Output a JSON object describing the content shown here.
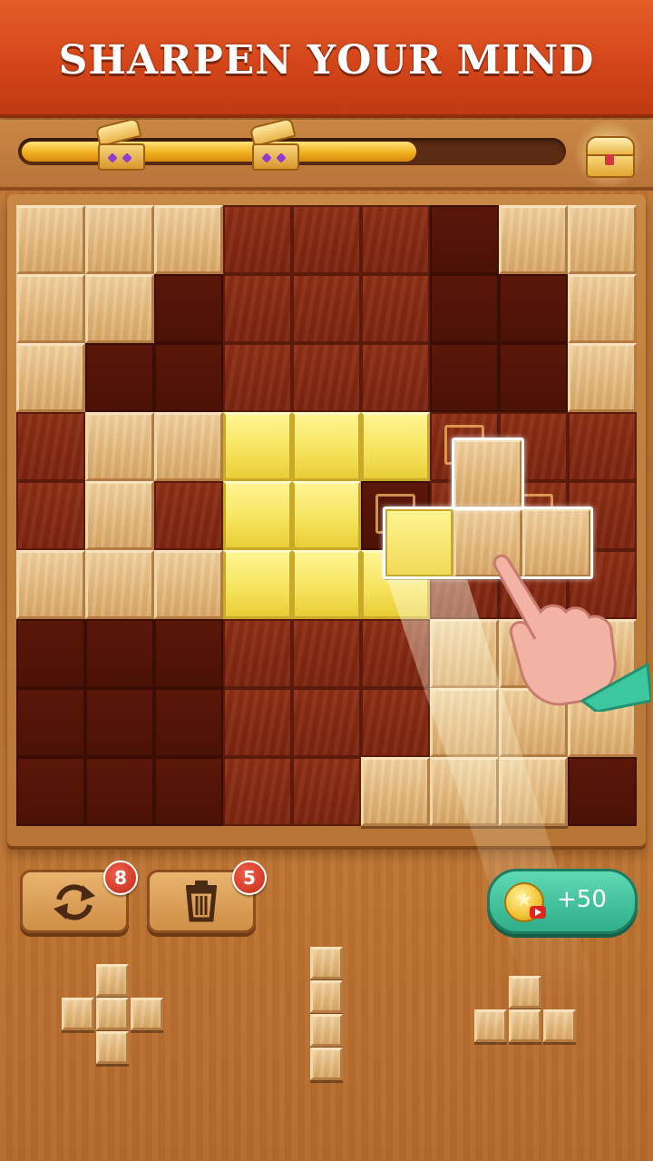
{
  "banner": {
    "title": "SHARPEN YOUR MIND"
  },
  "progress": {
    "fill_fraction": 0.73,
    "milestone_chests": 2,
    "reward_chest": "treasure-chest-icon"
  },
  "board": {
    "size": 9,
    "cells": [
      [
        "w",
        "w",
        "w",
        "e",
        "e",
        "e",
        "d",
        "w",
        "w"
      ],
      [
        "w",
        "w",
        "d",
        "e",
        "e",
        "e",
        "d",
        "d",
        "w"
      ],
      [
        "w",
        "d",
        "d",
        "e",
        "e",
        "e",
        "d",
        "d",
        "w"
      ],
      [
        "e",
        "w",
        "w",
        "h",
        "h",
        "h",
        "e",
        "e",
        "e"
      ],
      [
        "e",
        "w",
        "e",
        "h",
        "h",
        "d",
        "e",
        "e",
        "e"
      ],
      [
        "w",
        "w",
        "w",
        "h",
        "h",
        "h",
        "e",
        "e",
        "e"
      ],
      [
        "d",
        "d",
        "d",
        "e",
        "e",
        "e",
        "w",
        "w",
        "w"
      ],
      [
        "d",
        "d",
        "d",
        "e",
        "e",
        "e",
        "w",
        "w",
        "w"
      ],
      [
        "d",
        "d",
        "d",
        "e",
        "e",
        "w",
        "w",
        "w",
        "d"
      ]
    ],
    "legend": {
      "w": "wood-block",
      "e": "empty-cell",
      "d": "dark-cell",
      "h": "highlighted-block"
    },
    "dragged_piece": "t-shape"
  },
  "toolbar": {
    "rotate": {
      "icon": "rotate-icon",
      "count": "8"
    },
    "delete": {
      "icon": "trash-icon",
      "count": "5"
    },
    "coin_reward": {
      "icon": "coin-icon",
      "label": "+50"
    }
  },
  "tray": {
    "pieces": [
      {
        "name": "plus-piece"
      },
      {
        "name": "vertical-i-piece"
      },
      {
        "name": "t-piece"
      }
    ]
  }
}
